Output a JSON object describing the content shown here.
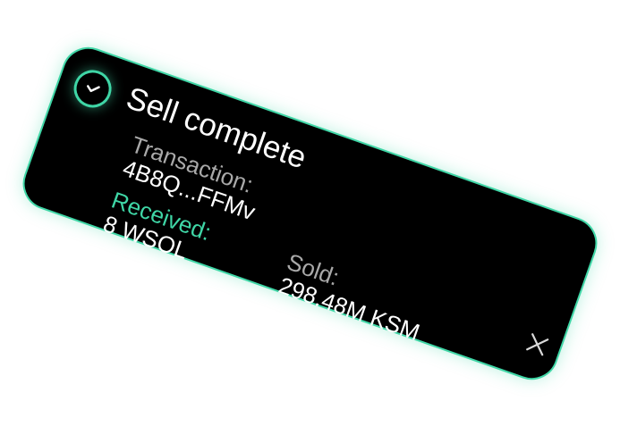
{
  "toast": {
    "title": "Sell complete",
    "transaction": {
      "label": "Transaction:",
      "value": "4B8Q...FFMv"
    },
    "received": {
      "label": "Received:",
      "value": "8 WSOL"
    },
    "sold": {
      "label": "Sold:",
      "value": "298.48M KSM"
    },
    "status_icon": "check-icon",
    "close_icon": "close-icon"
  },
  "colors": {
    "background": "#000000",
    "accent": "#3fd6a6",
    "label": "#a9a9a9",
    "text": "#ffffff"
  }
}
